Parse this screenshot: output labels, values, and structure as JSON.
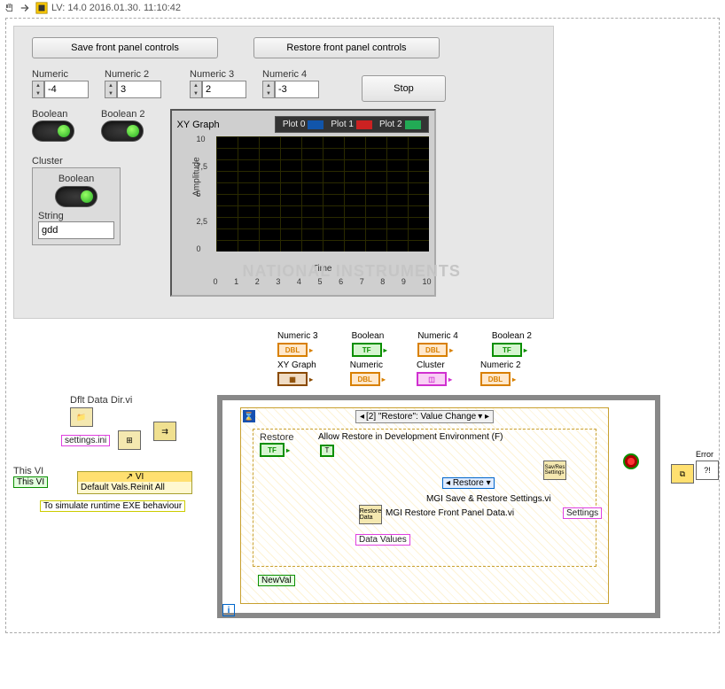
{
  "titlebar": {
    "text": "LV: 14.0 2016.01.30. 11:10:42"
  },
  "front_panel": {
    "save_btn": "Save front panel controls",
    "restore_btn": "Restore front panel controls",
    "stop_btn": "Stop",
    "numeric": {
      "label": "Numeric",
      "value": "-4"
    },
    "numeric2": {
      "label": "Numeric 2",
      "value": "3"
    },
    "numeric3": {
      "label": "Numeric 3",
      "value": "2"
    },
    "numeric4": {
      "label": "Numeric 4",
      "value": "-3"
    },
    "boolean": {
      "label": "Boolean"
    },
    "boolean2": {
      "label": "Boolean 2"
    },
    "cluster": {
      "label": "Cluster",
      "bool_label": "Boolean",
      "str_label": "String",
      "str_value": "gdd"
    },
    "graph": {
      "label": "XY Graph",
      "legend": [
        "Plot 0",
        "Plot 1",
        "Plot 2"
      ],
      "ylabel": "Amplitude",
      "xlabel": "Time",
      "yticks": [
        "10",
        "7,5",
        "5",
        "2,5",
        "0"
      ],
      "xticks": [
        "0",
        "1",
        "2",
        "3",
        "4",
        "5",
        "6",
        "7",
        "8",
        "9",
        "10"
      ],
      "watermark": "NATIONAL INSTRUMENTS"
    }
  },
  "chart_data": {
    "type": "line",
    "title": "XY Graph",
    "xlabel": "Time",
    "ylabel": "Amplitude",
    "xlim": [
      0,
      10
    ],
    "ylim": [
      0,
      10
    ],
    "series": [
      {
        "name": "Plot 0",
        "x": [],
        "y": []
      },
      {
        "name": "Plot 1",
        "x": [],
        "y": []
      },
      {
        "name": "Plot 2",
        "x": [],
        "y": []
      }
    ]
  },
  "terminals_row1": [
    {
      "label": "Numeric 3",
      "type": "DBL"
    },
    {
      "label": "Boolean",
      "type": "TF"
    },
    {
      "label": "Numeric 4",
      "type": "DBL"
    },
    {
      "label": "Boolean 2",
      "type": "TF"
    }
  ],
  "terminals_row2": [
    {
      "label": "XY Graph",
      "type": "XY"
    },
    {
      "label": "Numeric",
      "type": "DBL"
    },
    {
      "label": "Cluster",
      "type": "CLST"
    },
    {
      "label": "Numeric 2",
      "type": "DBL"
    }
  ],
  "diagram": {
    "dflt_data": "Dflt Data Dir.vi",
    "settings_ini": "settings.ini",
    "this_vi": "This VI",
    "this_vi_box": "This VI",
    "vi_box": "VI",
    "reinit": "Default Vals.Reinit All",
    "simulate": "To simulate runtime EXE behaviour",
    "case_selector": "[2] \"Restore\": Value Change",
    "restore_lbl": "Restore",
    "allow_restore": "Allow Restore in Development Environment (F)",
    "restore_dropdown": "Restore",
    "mgi_restore": "MGI Restore Front Panel Data.vi",
    "data_values": "Data Values",
    "newval": "NewVal",
    "mgi_saverestore": "MGI Save & Restore Settings.vi",
    "settings_out": "Settings",
    "error_out": "Error"
  }
}
